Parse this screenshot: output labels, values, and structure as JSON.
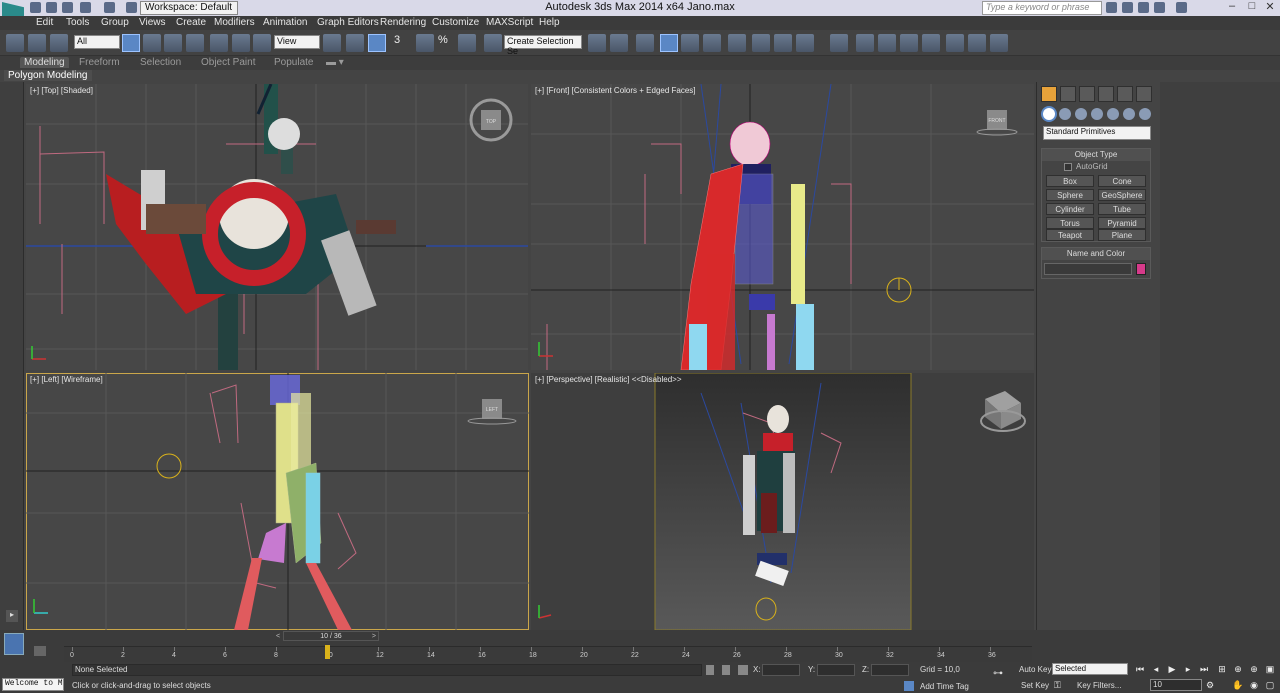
{
  "titlebar": {
    "workspace": "Workspace: Default",
    "title": "Autodesk 3ds Max  2014 x64      Jano.max",
    "search_placeholder": "Type a keyword or phrase"
  },
  "menu": [
    "Edit",
    "Tools",
    "Group",
    "Views",
    "Create",
    "Modifiers",
    "Animation",
    "Graph Editors",
    "Rendering",
    "Customize",
    "MAXScript",
    "Help"
  ],
  "toolbar": {
    "selection_filter": "All",
    "ref_coord": "View",
    "named_selection": "Create Selection Se",
    "snap_label": "3",
    "angle_snap": "%"
  },
  "ribbon": {
    "tabs": [
      "Modeling",
      "Freeform",
      "Selection",
      "Object Paint",
      "Populate"
    ],
    "active_tab": "Modeling",
    "panel": "Polygon Modeling"
  },
  "viewports": {
    "top": "[+] [Top] [Shaded]",
    "front": "[+] [Front] [Consistent Colors + Edged Faces]",
    "left": "[+] [Left] [Wireframe]",
    "perspective": "[+] [Perspective] [Realistic]  <<Disabled>>"
  },
  "viewcube": {
    "top": "TOP",
    "front": "FRONT",
    "left": "LEFT"
  },
  "command_panel": {
    "category": "Standard Primitives",
    "object_type_title": "Object Type",
    "autogrid": "AutoGrid",
    "buttons": [
      "Box",
      "Cone",
      "Sphere",
      "GeoSphere",
      "Cylinder",
      "Tube",
      "Torus",
      "Pyramid",
      "Teapot",
      "Plane"
    ],
    "name_color_title": "Name and Color",
    "name_value": "",
    "swatch_color": "#d63a8a"
  },
  "timeline": {
    "frame_slider": "10 / 36",
    "ticks": [
      "0",
      "2",
      "4",
      "6",
      "8",
      "10",
      "12",
      "14",
      "16",
      "18",
      "20",
      "22",
      "24",
      "26",
      "28",
      "30",
      "32",
      "34",
      "36"
    ],
    "current_frame": 10,
    "total_frames": 36
  },
  "status": {
    "maxscript": "Welcome to M",
    "selection": "None Selected",
    "prompt": "Click or click-and-drag to select objects",
    "x_label": "X:",
    "y_label": "Y:",
    "z_label": "Z:",
    "grid": "Grid = 10,0",
    "add_time_tag": "Add Time Tag",
    "auto_key": "Auto Key",
    "set_key": "Set Key",
    "key_mode_selected": "Selected",
    "key_filters": "Key Filters...",
    "frame_field": "10"
  },
  "colors": {
    "accent": "#5a87c5",
    "active_viewport_border": "#caa64a",
    "create_tab": "#e7a23a"
  }
}
